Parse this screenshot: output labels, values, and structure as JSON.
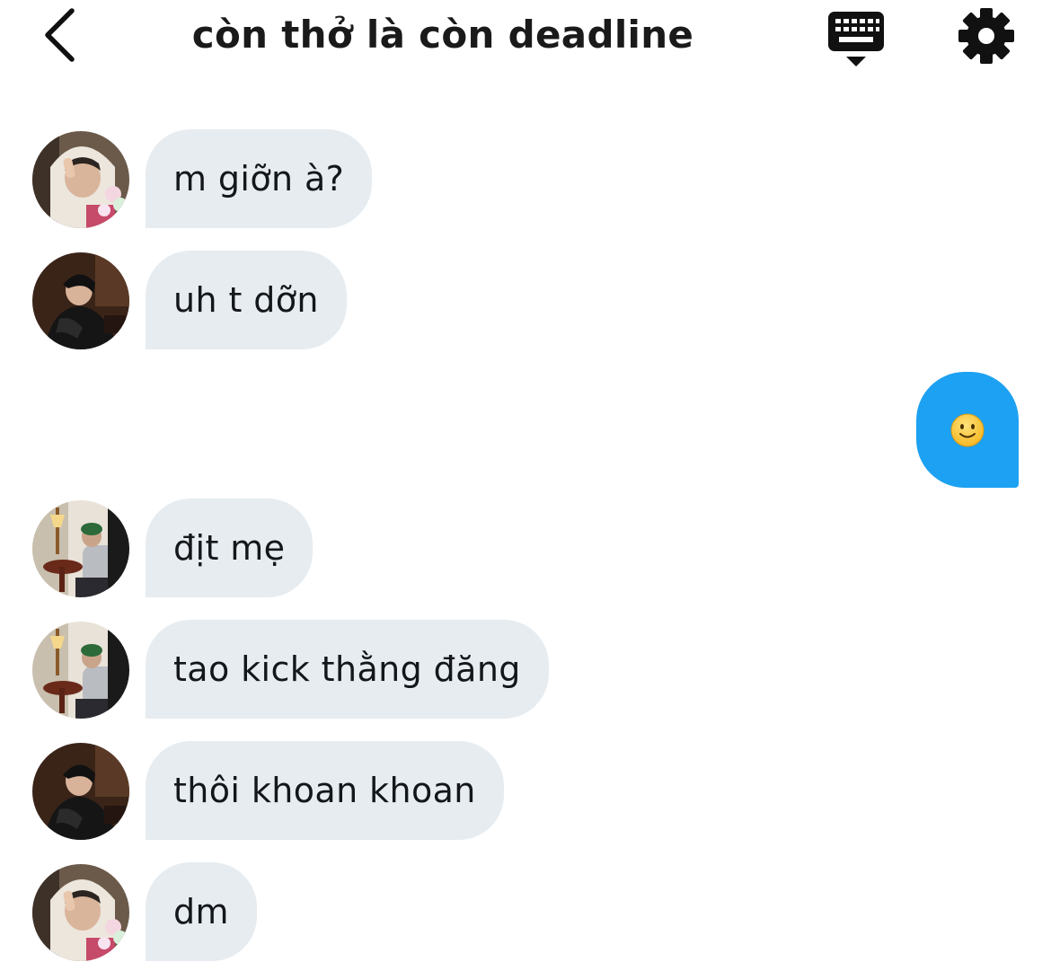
{
  "header": {
    "title": "còn thở là còn deadline",
    "back_icon": "chevron-left-icon",
    "keyboard_icon": "keyboard-icon",
    "settings_icon": "gear-icon"
  },
  "colors": {
    "incoming_bubble": "#e6ecf0",
    "outgoing_bubble": "#1da1f2",
    "text": "#14171a"
  },
  "messages": [
    {
      "sender": "a",
      "text": "m giỡn à?"
    },
    {
      "sender": "b",
      "text": "uh t dỡn"
    },
    {
      "sender": "me",
      "text": "🙂",
      "emoji": "slightly-smiling-face"
    },
    {
      "sender": "c",
      "text": "địt mẹ"
    },
    {
      "sender": "c",
      "text": "tao kick thằng đăng"
    },
    {
      "sender": "b",
      "text": "thôi khoan khoan"
    },
    {
      "sender": "a",
      "text": "dm"
    }
  ]
}
